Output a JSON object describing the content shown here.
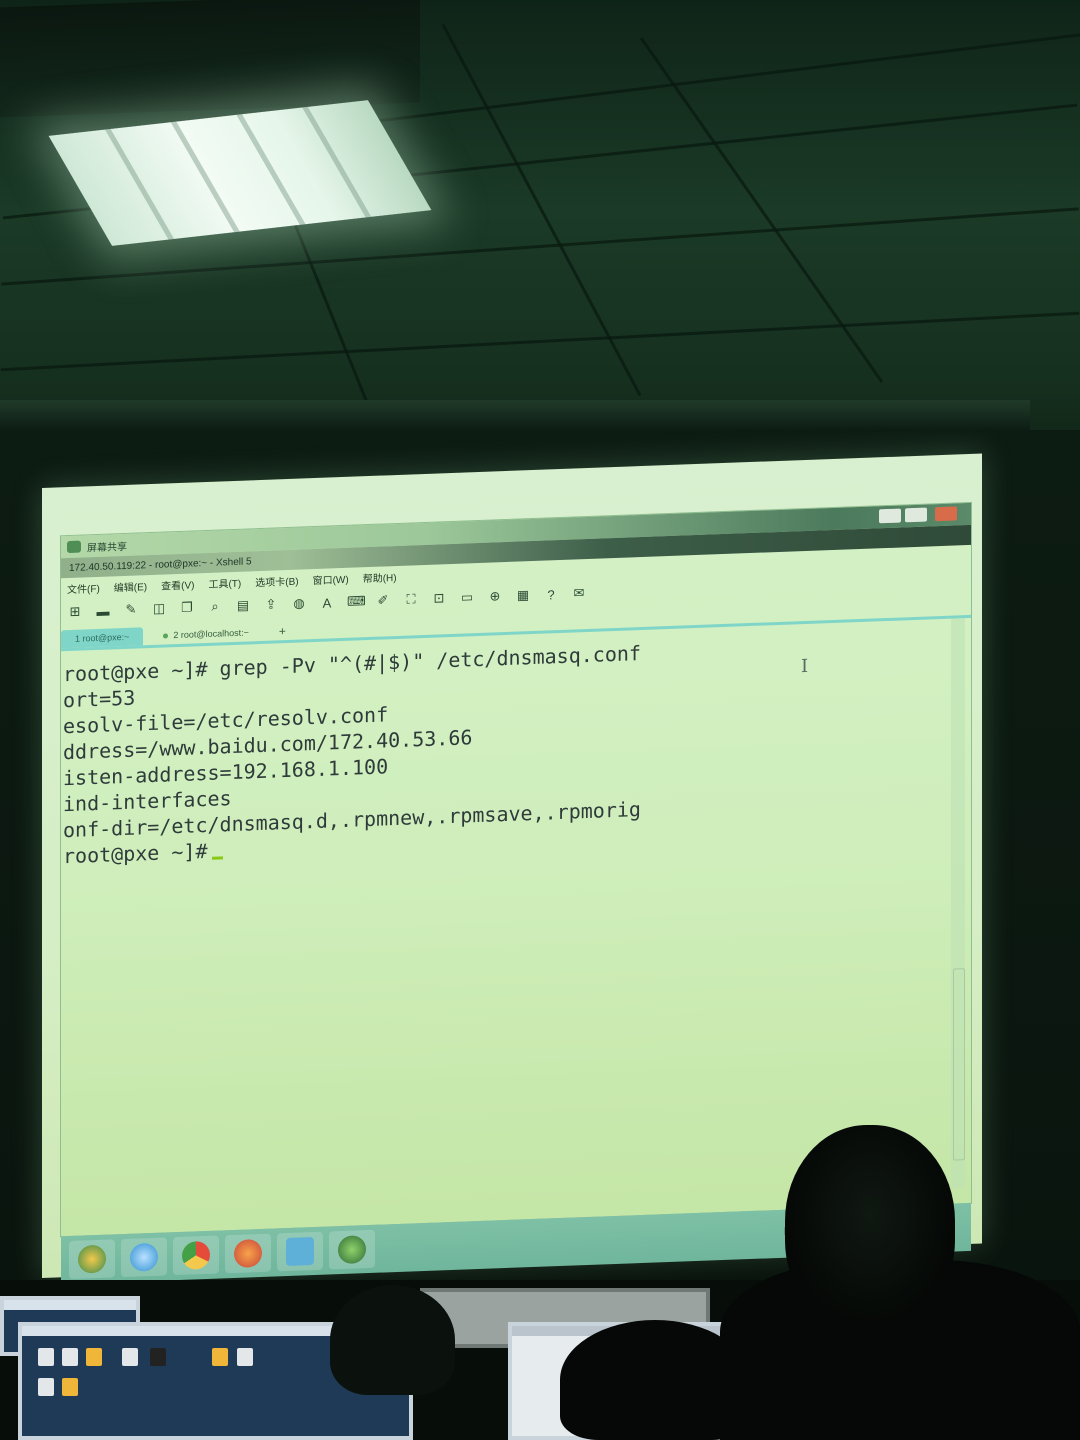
{
  "share_bar": {
    "title": "屏幕共享"
  },
  "window": {
    "title": "172.40.50.119:22 - root@pxe:~ - Xshell 5"
  },
  "menu": [
    "文件(F)",
    "编辑(E)",
    "查看(V)",
    "工具(T)",
    "选项卡(B)",
    "窗口(W)",
    "帮助(H)"
  ],
  "tabs": [
    {
      "label": "1 root@pxe:~",
      "active": true
    },
    {
      "label": "2 root@localhost:~",
      "active": false
    }
  ],
  "tab_add": "+",
  "terminal": {
    "lines": [
      "root@pxe ~]# grep -Pv \"^(#|$)\" /etc/dnsmasq.conf",
      "ort=53",
      "esolv-file=/etc/resolv.conf",
      "ddress=/www.baidu.com/172.40.53.66",
      "isten-address=192.168.1.100",
      "ind-interfaces",
      "onf-dir=/etc/dnsmasq.d,.rpmnew,.rpmsave,.rpmorig",
      "root@pxe ~]#"
    ],
    "cursor_color": "#8ac818"
  },
  "colors": {
    "terminal_bg": "#cfeebb",
    "tab_accent": "#7fd6c8",
    "taskbar": "#7ec0a6"
  },
  "toolbar_icons": [
    "new-session-icon",
    "open-folder-icon",
    "connect-icon",
    "properties-icon",
    "copy-icon",
    "find-icon",
    "print-icon",
    "transfer-icon",
    "globe-icon",
    "font-icon",
    "keyboard-icon",
    "script-icon",
    "fullscreen-icon",
    "lock-icon",
    "compose-icon",
    "add-icon",
    "layout-icon",
    "help-icon",
    "chat-icon"
  ],
  "taskbar_icons": [
    "start-icon",
    "ie-icon",
    "chrome-icon",
    "firefox-icon",
    "explorer-icon",
    "xshell-icon"
  ]
}
